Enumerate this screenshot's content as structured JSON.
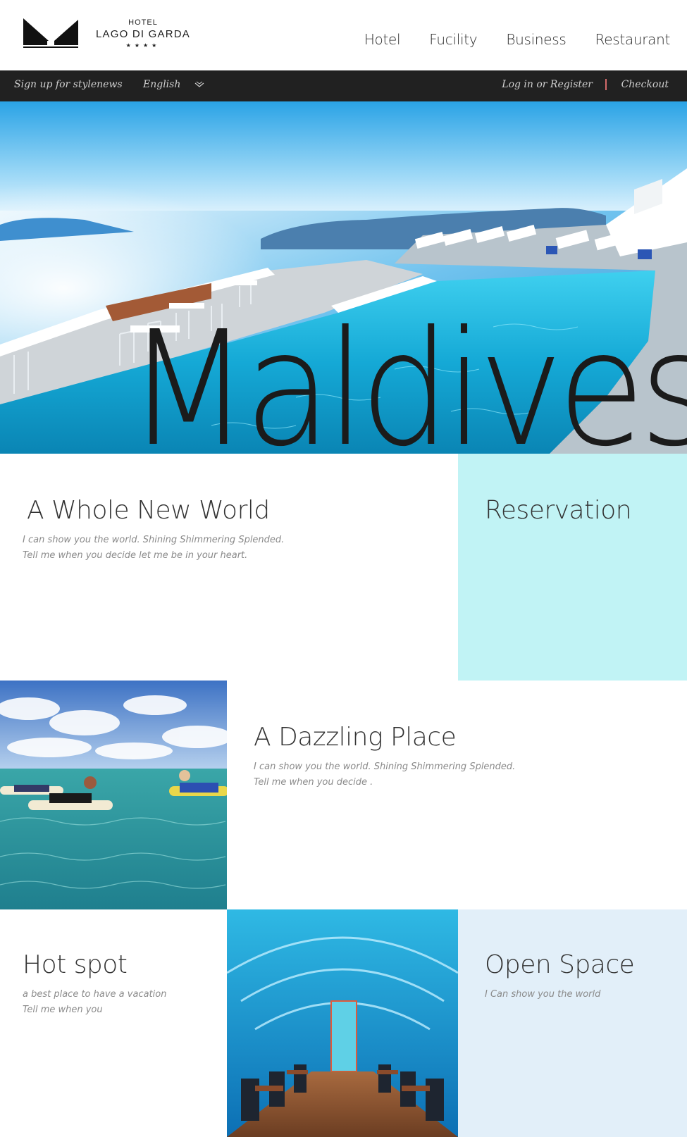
{
  "logo": {
    "hotel": "HOTEL",
    "name": "LAGO DI GARDA",
    "stars": "★★★★"
  },
  "nav": {
    "items": [
      {
        "label": "Hotel"
      },
      {
        "label": "Fucility"
      },
      {
        "label": "Business"
      },
      {
        "label": "Restaurant"
      }
    ]
  },
  "topbar": {
    "signup": "Sign up for stylenews",
    "language": "English",
    "login": "Log in or Register",
    "checkout": "Checkout"
  },
  "hero": {
    "title": "Maldives"
  },
  "sections": {
    "world": {
      "title": "A Whole New World",
      "line1": "I can show you the world. Shining Shimmering Splended.",
      "line2": "Tell me when you decide let me be in your heart."
    },
    "reservation": {
      "title": "Reservation"
    },
    "dazzling": {
      "title": "A Dazzling Place",
      "line1": "I can show you the world. Shining Shimmering Splended.",
      "line2": "Tell me when you decide ."
    },
    "hotspot": {
      "title": "Hot spot",
      "line1": "a best place to have a vacation",
      "line2": "Tell me when you"
    },
    "openspace": {
      "title": "Open Space",
      "line1": "I Can show you the world"
    }
  },
  "colors": {
    "topbar_bg": "#212121",
    "reservation_bg": "#c1f3f5",
    "openspace_bg": "#e2eff9",
    "separator": "#d46a6a"
  }
}
